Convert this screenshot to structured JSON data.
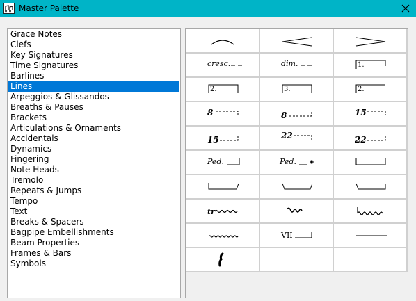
{
  "window": {
    "title": "Master Palette",
    "close_icon": "close-icon",
    "app_icon": "musescore-logo-icon"
  },
  "categories": {
    "items": [
      "Grace Notes",
      "Clefs",
      "Key Signatures",
      "Time Signatures",
      "Barlines",
      "Lines",
      "Arpeggios & Glissandos",
      "Breaths & Pauses",
      "Brackets",
      "Articulations & Ornaments",
      "Accidentals",
      "Dynamics",
      "Fingering",
      "Note Heads",
      "Tremolo",
      "Repeats & Jumps",
      "Tempo",
      "Text",
      "Breaks & Spacers",
      "Bagpipe Embellishments",
      "Beam Properties",
      "Frames & Bars",
      "Symbols"
    ],
    "selected": "Lines"
  },
  "palette": {
    "cells": {
      "cresc": "cresc.",
      "dim": "dim.",
      "volta1": "1.",
      "volta2a": "2.",
      "volta3": "3.",
      "volta2b": "2.",
      "ottava8a": "8",
      "ottava8b": "8",
      "ottava15a": "15",
      "ottava15b": "15",
      "ottava22a": "22",
      "ottava22b": "22",
      "ped1": "Ped.",
      "ped2": "Ped.",
      "string_number": "VII"
    }
  }
}
